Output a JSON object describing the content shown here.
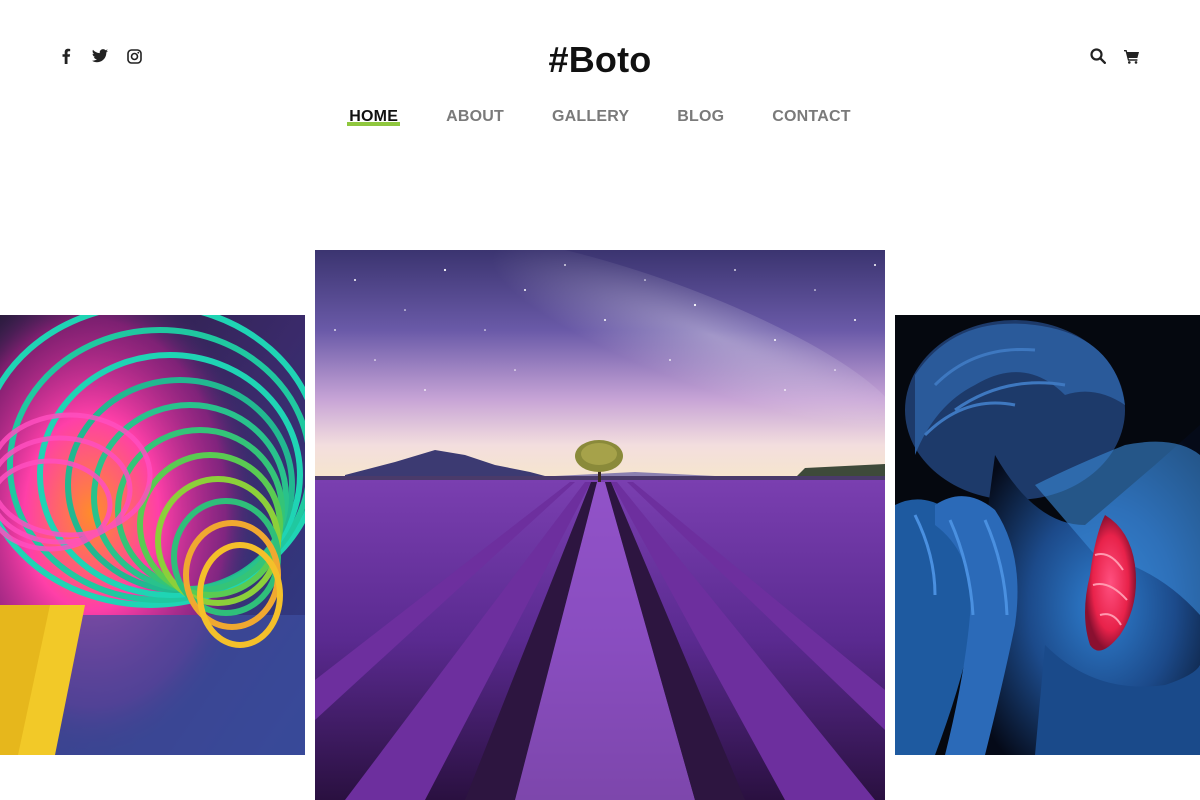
{
  "brand": {
    "title": "#Boto"
  },
  "social": [
    {
      "icon": "facebook-icon"
    },
    {
      "icon": "twitter-icon"
    },
    {
      "icon": "instagram-icon"
    }
  ],
  "utilities": [
    {
      "icon": "search-icon"
    },
    {
      "icon": "cart-icon"
    }
  ],
  "nav": {
    "items": [
      {
        "label": "HOME",
        "active": true
      },
      {
        "label": "ABOUT",
        "active": false
      },
      {
        "label": "GALLERY",
        "active": false
      },
      {
        "label": "BLOG",
        "active": false
      },
      {
        "label": "CONTACT",
        "active": false
      }
    ]
  },
  "colors": {
    "accent": "#8fc73e",
    "text": "#111111",
    "nav_inactive": "#7a7a7a"
  },
  "gallery": {
    "images": [
      {
        "name": "slinky-photo"
      },
      {
        "name": "lavender-field-photo"
      },
      {
        "name": "uv-body-paint-photo"
      }
    ]
  }
}
